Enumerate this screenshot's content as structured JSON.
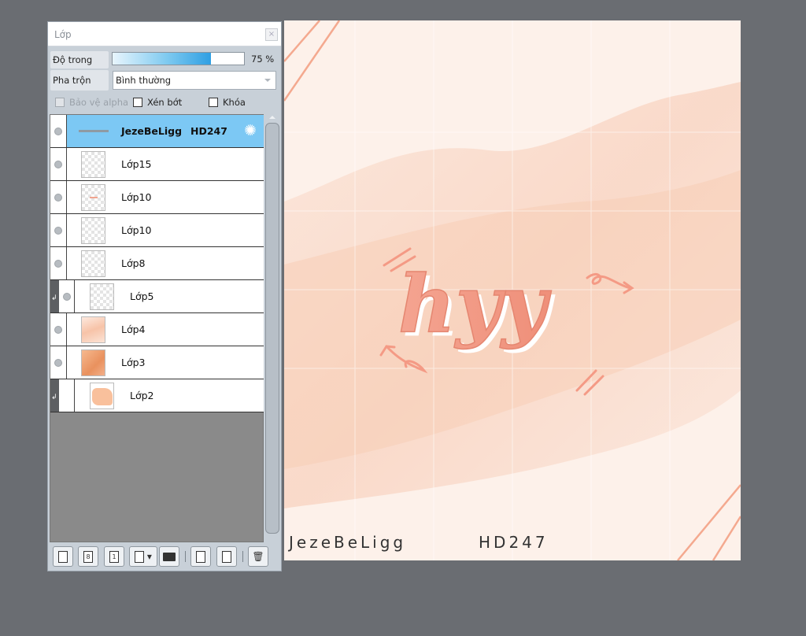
{
  "panel": {
    "title": "Lớp",
    "close_label": "×",
    "opacity_label": "Độ trong",
    "opacity_value": "75 %",
    "opacity_fraction": 0.75,
    "blend_label": "Pha trộn",
    "blend_value": "Bình thường",
    "checkboxes": {
      "alpha": "Bảo vệ alpha",
      "clip": "Xén bớt",
      "lock": "Khóa"
    }
  },
  "layers": [
    {
      "name": "JezeBeLigg",
      "name2": "HD247",
      "selected": true,
      "type": "text"
    },
    {
      "name": "Lớp15"
    },
    {
      "name": "Lớp10"
    },
    {
      "name": "Lớp10"
    },
    {
      "name": "Lớp8"
    },
    {
      "name": "Lớp5",
      "clipped": true
    },
    {
      "name": "Lớp4"
    },
    {
      "name": "Lớp3"
    },
    {
      "name": "Lớp2",
      "clipped": true
    }
  ],
  "toolbar": {
    "new_layer": "new-layer-icon",
    "new_8bit": "8",
    "new_1bit": "1",
    "add_menu": "add-layer-menu-icon",
    "folder": "folder-icon",
    "duplicate": "duplicate-icon",
    "merge": "merge-down-icon",
    "delete": "trash-icon"
  },
  "canvas": {
    "artwork_text": "hyy",
    "signature_left": "JezeBeLigg",
    "signature_right": "HD247",
    "colors": {
      "background": "#fdf1ea",
      "accent": "#f19a86",
      "selected_layer": "#7cc8f4"
    }
  }
}
